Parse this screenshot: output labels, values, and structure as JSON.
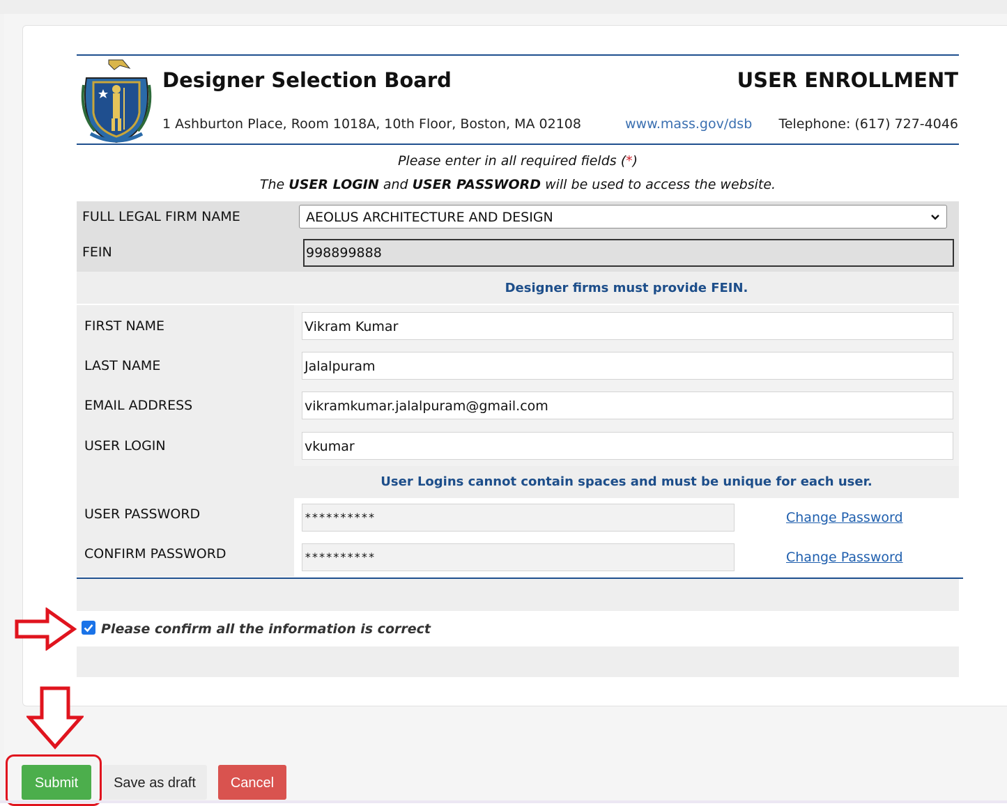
{
  "header": {
    "org_title": "Designer Selection Board",
    "page_heading": "USER ENROLLMENT",
    "address": "1 Ashburton Place, Room 1018A, 10th Floor, Boston, MA 02108",
    "website": "www.mass.gov/dsb",
    "telephone": "Telephone: (617) 727-4046",
    "seal_icon": "massachusetts-seal-icon"
  },
  "instructions": {
    "line1_prefix": "Please enter in all required fields (",
    "line1_star": "*",
    "line1_suffix": ")",
    "line2_the": "The ",
    "line2_login": "USER LOGIN",
    "line2_and": " and ",
    "line2_password": "USER PASSWORD",
    "line2_rest": " will be used to access the website."
  },
  "form": {
    "firm_name_label": "FULL LEGAL FIRM NAME",
    "firm_name_value": "AEOLUS ARCHITECTURE AND DESIGN",
    "fein_label": "FEIN",
    "fein_value": "998899888",
    "fein_note": "Designer firms must provide FEIN.",
    "first_name_label": "FIRST NAME",
    "first_name_value": "Vikram Kumar",
    "last_name_label": "LAST NAME",
    "last_name_value": "Jalalpuram",
    "email_label": "EMAIL ADDRESS",
    "email_value": "vikramkumar.jalalpuram@gmail.com",
    "login_label": "USER LOGIN",
    "login_value": "vkumar",
    "login_note": "User Logins cannot contain spaces and must be unique for each user.",
    "password_label": "USER PASSWORD",
    "password_value": "**********",
    "confirm_password_label": "CONFIRM PASSWORD",
    "confirm_password_value": "**********",
    "change_password_link": "Change Password",
    "confirm_checkbox_label": "Please confirm all the information is correct",
    "confirm_checked": true
  },
  "actions": {
    "submit_label": "Submit",
    "draft_label": "Save as draft",
    "cancel_label": "Cancel"
  },
  "colors": {
    "accent_blue": "#1e4f8e",
    "link_blue": "#1f5fae",
    "submit_green": "#4cae4c",
    "cancel_red": "#d9534f",
    "annotation_red": "#e0141e"
  }
}
